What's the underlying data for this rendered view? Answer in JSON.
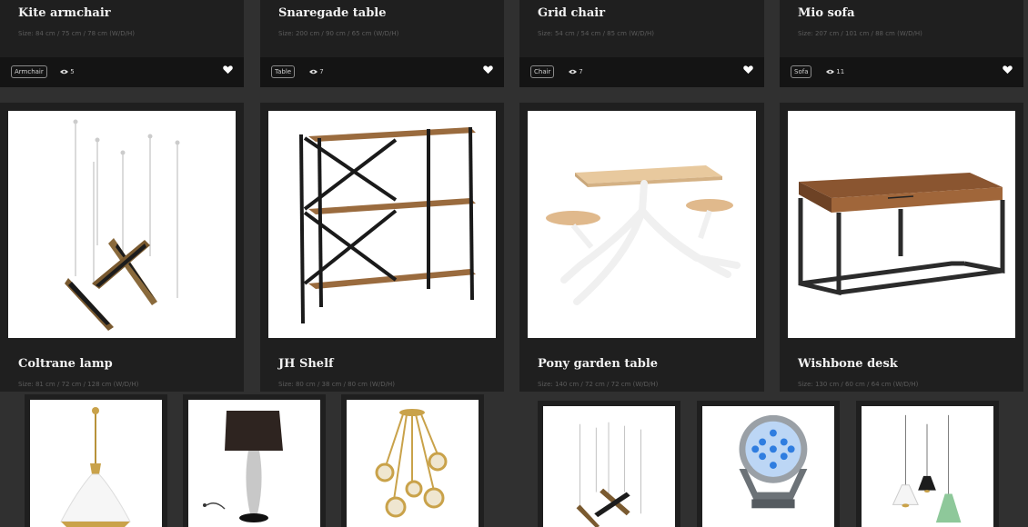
{
  "top_cards": [
    {
      "title": "Kite armchair",
      "size": "Size: 84 cm / 75 cm / 78 cm (W/D/H)",
      "tag": "Armchair",
      "views": "5"
    },
    {
      "title": "Snaregade table",
      "size": "Size: 200 cm / 90 cm / 65 cm (W/D/H)",
      "tag": "Table",
      "views": "7"
    },
    {
      "title": "Grid chair",
      "size": "Size: 54 cm / 54 cm / 85 cm (W/D/H)",
      "tag": "Chair",
      "views": "7"
    },
    {
      "title": "Mio sofa",
      "size": "Size: 207 cm / 101 cm / 88 cm (W/D/H)",
      "tag": "Sofa",
      "views": "11"
    }
  ],
  "mid_cards": [
    {
      "title": "Coltrane lamp",
      "size": "Size: 81 cm / 72 cm / 128 cm (W/D/H)"
    },
    {
      "title": "JH Shelf",
      "size": "Size: 80 cm / 38 cm / 80 cm (W/D/H)"
    },
    {
      "title": "Pony garden table",
      "size": "Size: 140 cm / 72 cm / 72 cm (W/D/H)"
    },
    {
      "title": "Wishbone desk",
      "size": "Size: 130 cm / 60 cm / 64 cm (W/D/H)"
    }
  ],
  "icons": {
    "views": "eye-icon",
    "favorite": "heart-icon"
  }
}
